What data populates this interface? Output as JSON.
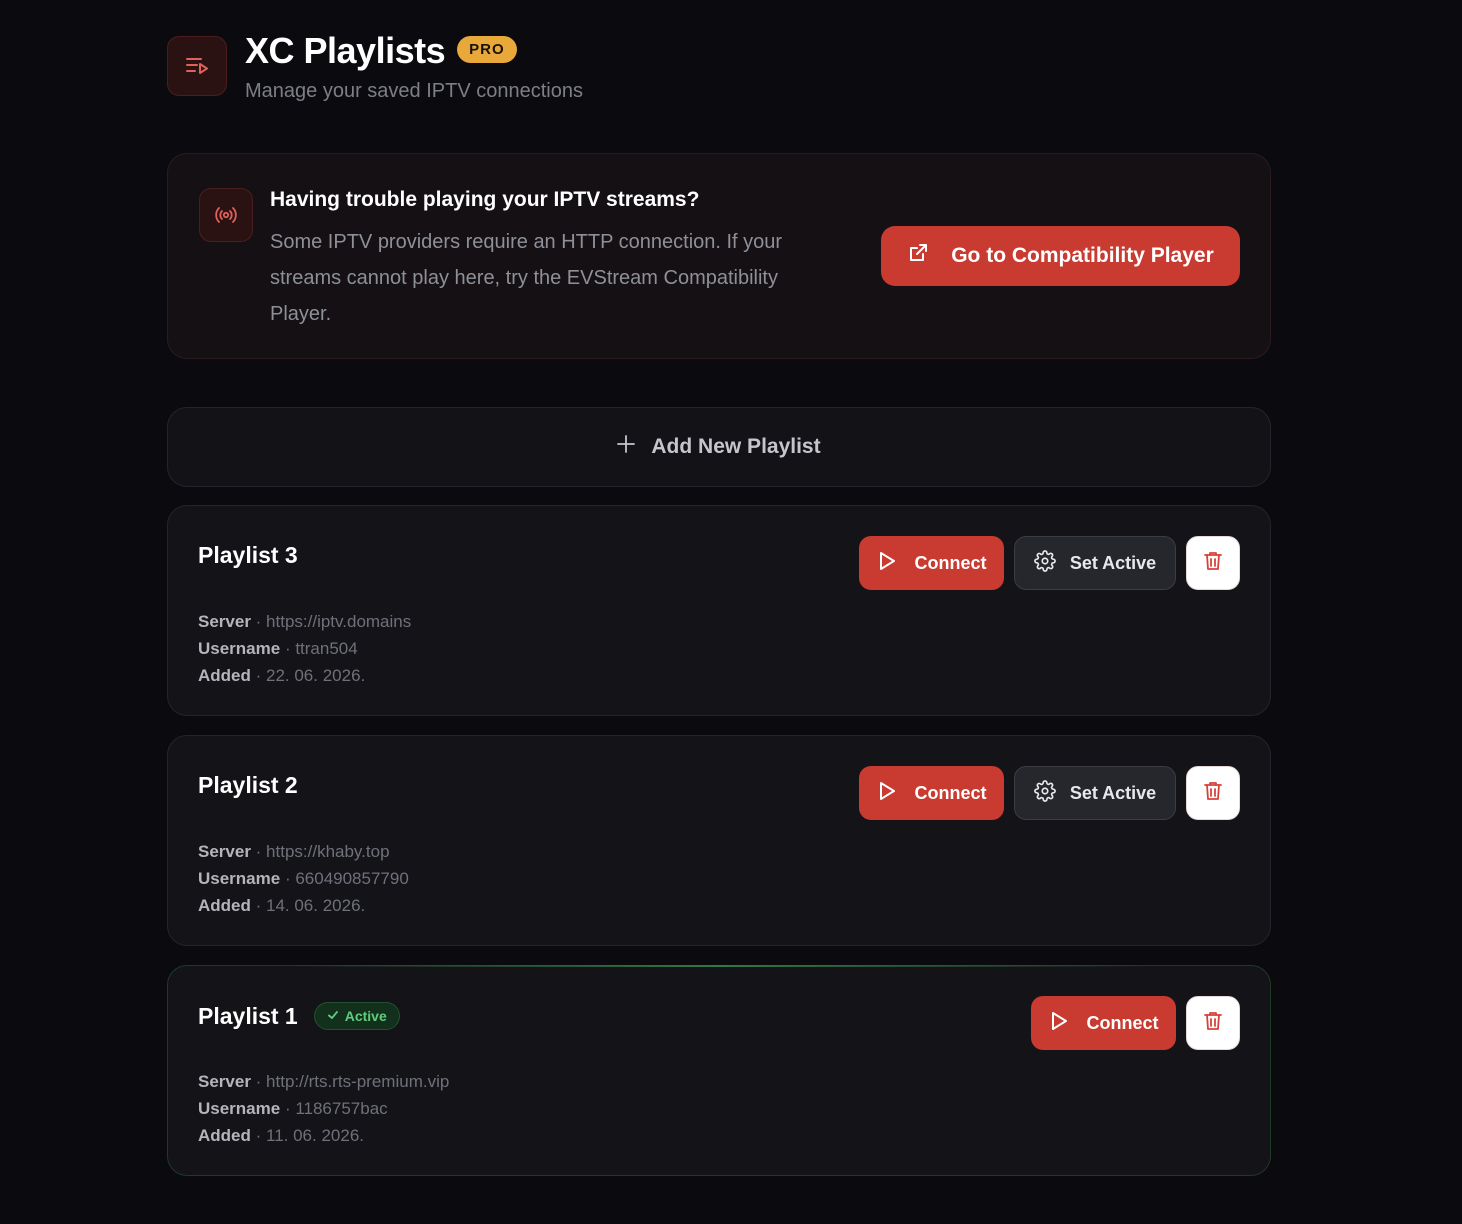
{
  "header": {
    "title": "XC Playlists",
    "badge": "PRO",
    "subtitle": "Manage your saved IPTV connections",
    "icon": "playlist-icon"
  },
  "notice": {
    "icon": "broadcast-icon",
    "title": "Having trouble playing your IPTV streams?",
    "text": "Some IPTV providers require an HTTP connection. If your streams cannot play here, try the EVStream Compatibility Player.",
    "button_label": "Go to Compatibility Player",
    "button_icon": "external-link-icon"
  },
  "add_button": {
    "label": "Add New Playlist",
    "icon": "plus-icon"
  },
  "labels": {
    "server": "Server",
    "username": "Username",
    "added": "Added",
    "separator": " · ",
    "connect": "Connect",
    "set_active": "Set Active",
    "active": "Active"
  },
  "playlists": [
    {
      "name": "Playlist 3",
      "server": "https://iptv.domains",
      "username": "ttran504",
      "added": "22. 06. 2026.",
      "active": false
    },
    {
      "name": "Playlist 2",
      "server": "https://khaby.top",
      "username": "660490857790",
      "added": "14. 06. 2026.",
      "active": false
    },
    {
      "name": "Playlist 1",
      "server": "http://rts.rts-premium.vip",
      "username": "1186757bac",
      "added": "11. 06. 2026.",
      "active": true
    }
  ],
  "colors": {
    "accent": "#c93a31",
    "pro_badge": "#e8a93a",
    "active_green": "#5fce7c",
    "background": "#0b0b0f"
  }
}
